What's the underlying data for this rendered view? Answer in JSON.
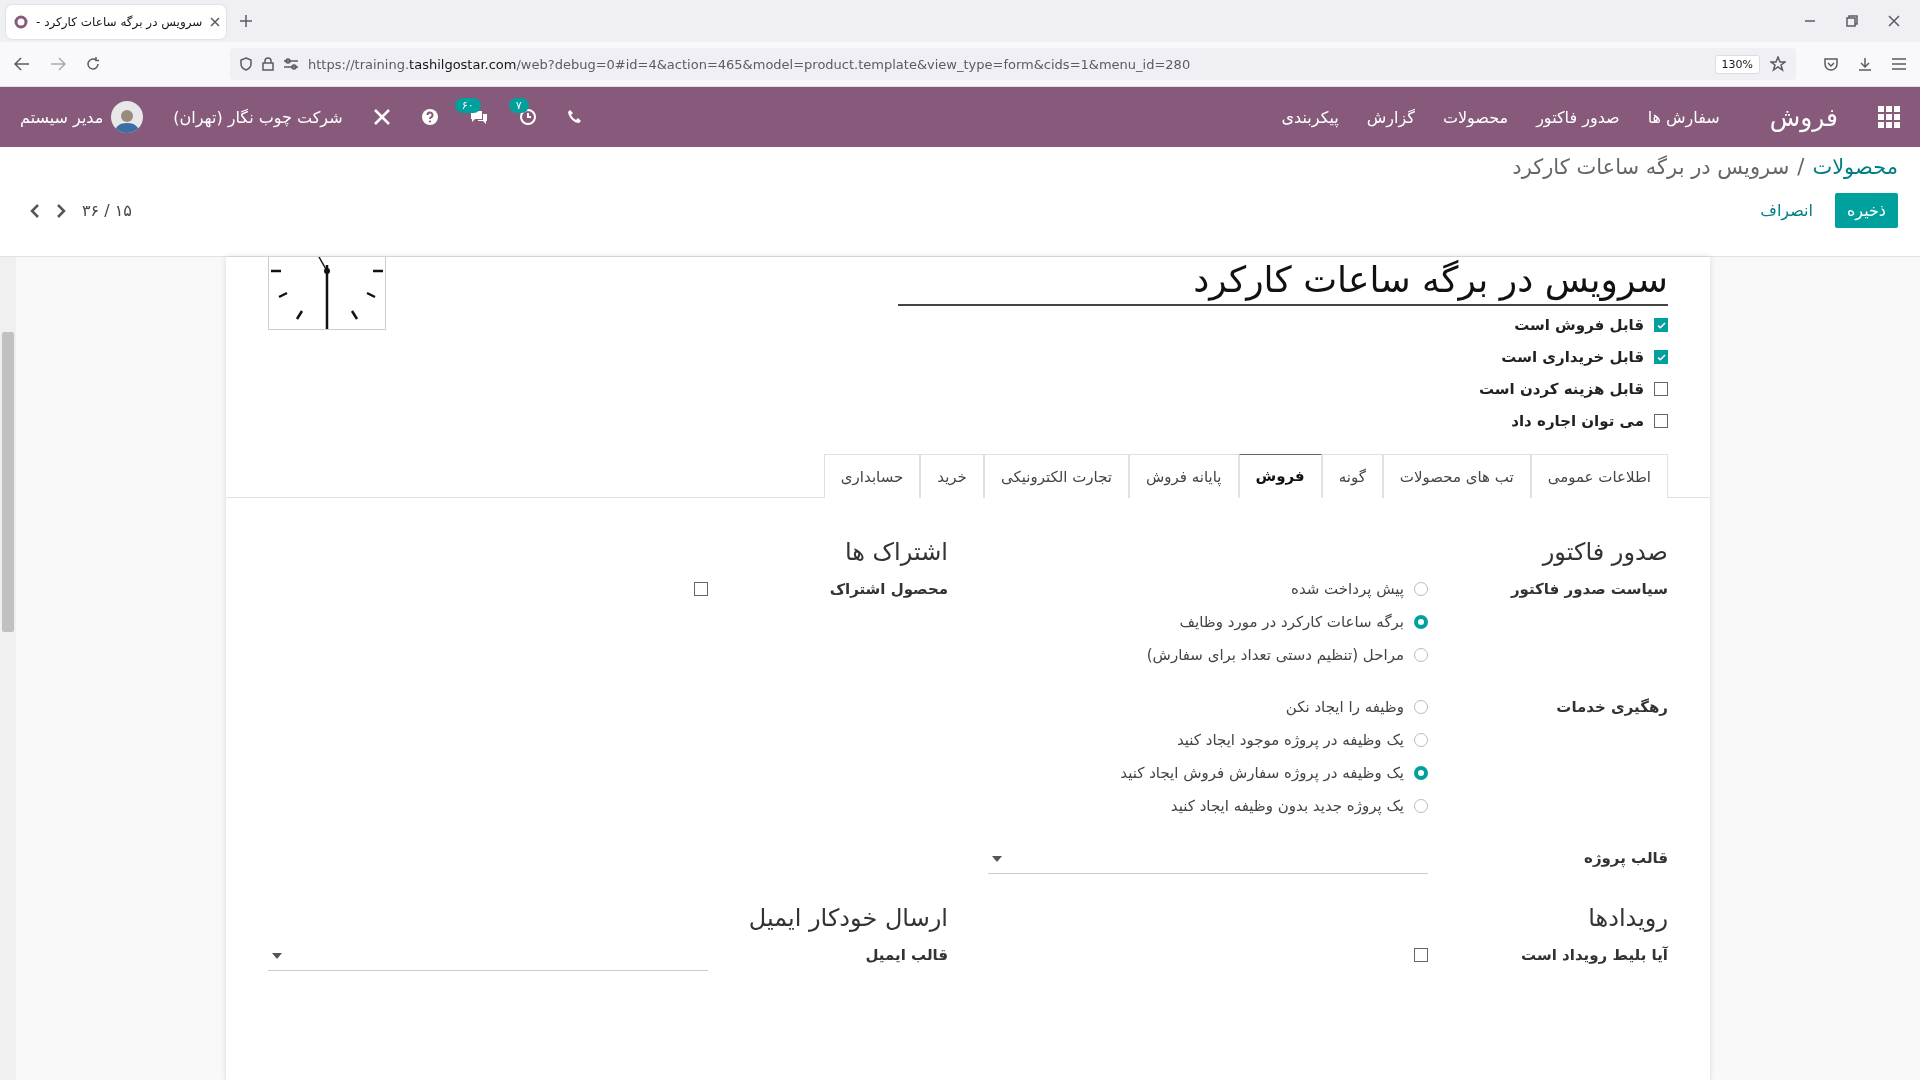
{
  "browser": {
    "tab_title": "سرویس در برگه ساعات کارکرد -",
    "url_prefix": "https://training.",
    "url_domain": "tashilgostar.com",
    "url_rest": "/web?debug=0#id=4&action=465&model=product.template&view_type=form&cids=1&menu_id=280",
    "zoom": "130%"
  },
  "navbar": {
    "app_name": "فروش",
    "menu": [
      "سفارش ها",
      "صدور فاکتور",
      "محصولات",
      "گزارش",
      "پیکربندی"
    ],
    "activity_count": "۷",
    "message_count": "۶۰",
    "company": "شرکت چوب نگار (تهران)",
    "user": "مدیر سیستم"
  },
  "control_panel": {
    "breadcrumb": [
      "محصولات",
      "سرویس در برگه ساعات کارکرد"
    ],
    "separator": "/",
    "save": "ذخیره",
    "discard": "انصراف",
    "pager": "۳۶ / ۱۵"
  },
  "form": {
    "name": "سرویس در برگه ساعات کارکرد",
    "options": [
      {
        "label": "قابل فروش است",
        "checked": true
      },
      {
        "label": "قابل خریداری است",
        "checked": true
      },
      {
        "label": "قابل هزینه کردن است",
        "checked": false
      },
      {
        "label": "می توان اجاره داد",
        "checked": false
      }
    ],
    "tabs": [
      {
        "label": "اطلاعات عمومی",
        "selected": false
      },
      {
        "label": "تب های محصولات",
        "selected": false
      },
      {
        "label": "گونه",
        "selected": false
      },
      {
        "label": "فروش",
        "selected": true
      },
      {
        "label": "پایانه فروش",
        "selected": false
      },
      {
        "label": "تجارت الکترونیکی",
        "selected": false
      },
      {
        "label": "خرید",
        "selected": false
      },
      {
        "label": "حسابداری",
        "selected": false
      }
    ],
    "sections": [
      {
        "title": "صدور فاکتور",
        "fields": [
          {
            "kind": "radio",
            "label": "سیاست صدور فاکتور",
            "options": [
              {
                "label": "پیش پرداخت شده",
                "selected": false
              },
              {
                "label": "برگه ساعات کارکرد در مورد وظایف",
                "selected": true
              },
              {
                "label": "مراحل (تنظیم دستی تعداد برای سفارش)",
                "selected": false
              }
            ]
          },
          {
            "kind": "radio",
            "label": "رهگیری خدمات",
            "options": [
              {
                "label": "وظیفه را ایجاد نکن",
                "selected": false
              },
              {
                "label": "یک وظیفه در پروژه موجود ایجاد کنید",
                "selected": false
              },
              {
                "label": "یک وظیفه در پروژه سفارش فروش ایجاد کنید",
                "selected": true
              },
              {
                "label": "یک پروژه جدید بدون وظیفه ایجاد کنید",
                "selected": false
              }
            ]
          },
          {
            "kind": "select",
            "label": "قالب پروژه"
          }
        ]
      },
      {
        "title": "اشتراک ها",
        "fields": [
          {
            "kind": "checkbox",
            "label": "محصول اشتراک",
            "checked": false
          }
        ]
      },
      {
        "title": "رویدادها",
        "fields": [
          {
            "kind": "checkbox",
            "label": "آیا بلیط رویداد است",
            "checked": false
          }
        ]
      },
      {
        "title": "ارسال خودکار ایمیل",
        "fields": [
          {
            "kind": "select",
            "label": "قالب ایمیل"
          }
        ]
      }
    ]
  }
}
